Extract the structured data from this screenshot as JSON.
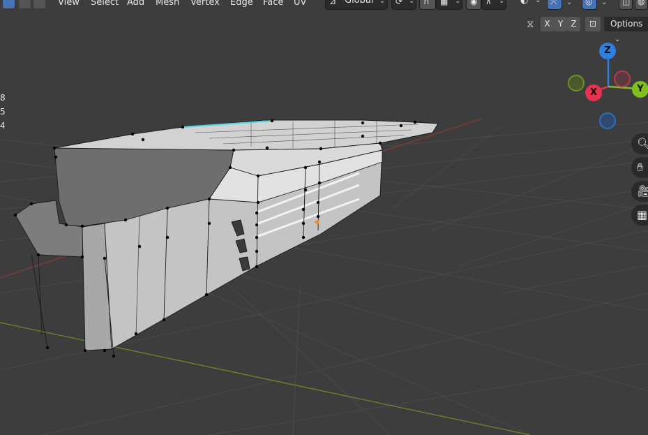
{
  "header": {
    "menu": [
      "View",
      "Select",
      "Add",
      "Mesh",
      "Vertex",
      "Edge",
      "Face",
      "UV"
    ],
    "transform_orientation": "Global"
  },
  "axis_buttons": [
    "X",
    "Y",
    "Z"
  ],
  "options_label": "Options",
  "gizmo": {
    "z": "Z",
    "x": "X",
    "y": "Y"
  },
  "stats_digits": [
    "8",
    "5",
    "4"
  ],
  "icons": {
    "orientation": "transform-orientation-icon",
    "pivot": "pivot-icon",
    "snap": "magnet-icon",
    "proportional": "proportional-edit-icon",
    "visibility": "eye-icon",
    "gizmo_toggle": "gizmo-icon",
    "overlay": "overlay-icon",
    "xray": "xray-icon",
    "mirror": "mirror-icon",
    "zoom": "zoom-icon",
    "pan": "hand-icon",
    "camera": "camera-icon",
    "perspective": "grid-icon"
  },
  "colors": {
    "background": "#3d3d3d",
    "grid": "#4a4a4a",
    "x_axis": "#8a3a3a",
    "y_axis": "#6a8a2a",
    "gizmo_x": "#e8334f",
    "gizmo_y": "#7fbf1f",
    "gizmo_z": "#2f7fe0",
    "mesh_face": "#b8b8b8",
    "accent": "#4772b3"
  }
}
